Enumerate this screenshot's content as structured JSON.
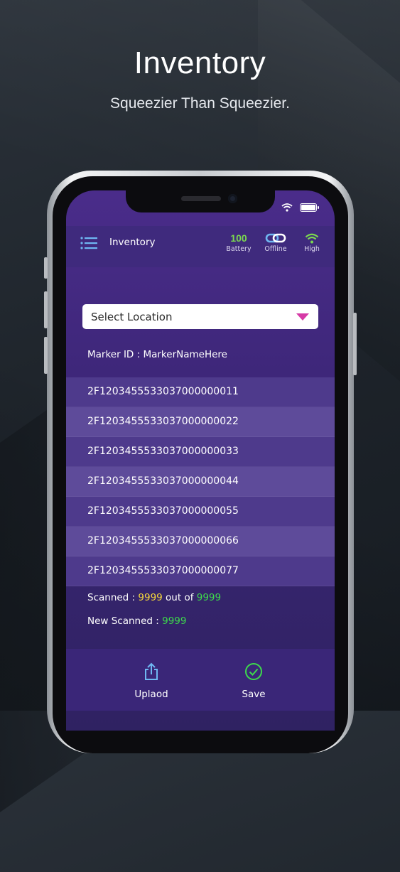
{
  "promo": {
    "headline": "Inventory",
    "tagline": "Squeezier Than Squeezier."
  },
  "header": {
    "title": "Inventory",
    "battery_value": "100",
    "battery_label": "Battery",
    "connection_label": "Offline",
    "signal_label": "High"
  },
  "location_select": {
    "selected": "Select Location"
  },
  "marker": {
    "text": "Marker ID : MarkerNameHere"
  },
  "tags": [
    "2F120345553303700000001​1",
    "2F1203455533037000000022",
    "2F1203455533037000000033",
    "2F1203455533037000000044",
    "2F1203455533037000000055",
    "2F1203455533037000000066",
    "2F1203455533037000000077"
  ],
  "summary": {
    "scanned_label": "Scanned : ",
    "scanned_value": "9999",
    "out_of_label": " out of ",
    "total_value": "9999",
    "new_scanned_label": "New Scanned : ",
    "new_scanned_value": "9999"
  },
  "bottom_bar": {
    "upload_label": "Uplaod",
    "save_label": "Save"
  },
  "colors": {
    "accent_pink": "#d63aa6",
    "battery_green": "#7bd84f",
    "value_yellow": "#f6d83b",
    "value_green": "#3ddb4b",
    "link_blue": "#6fb7f2"
  }
}
